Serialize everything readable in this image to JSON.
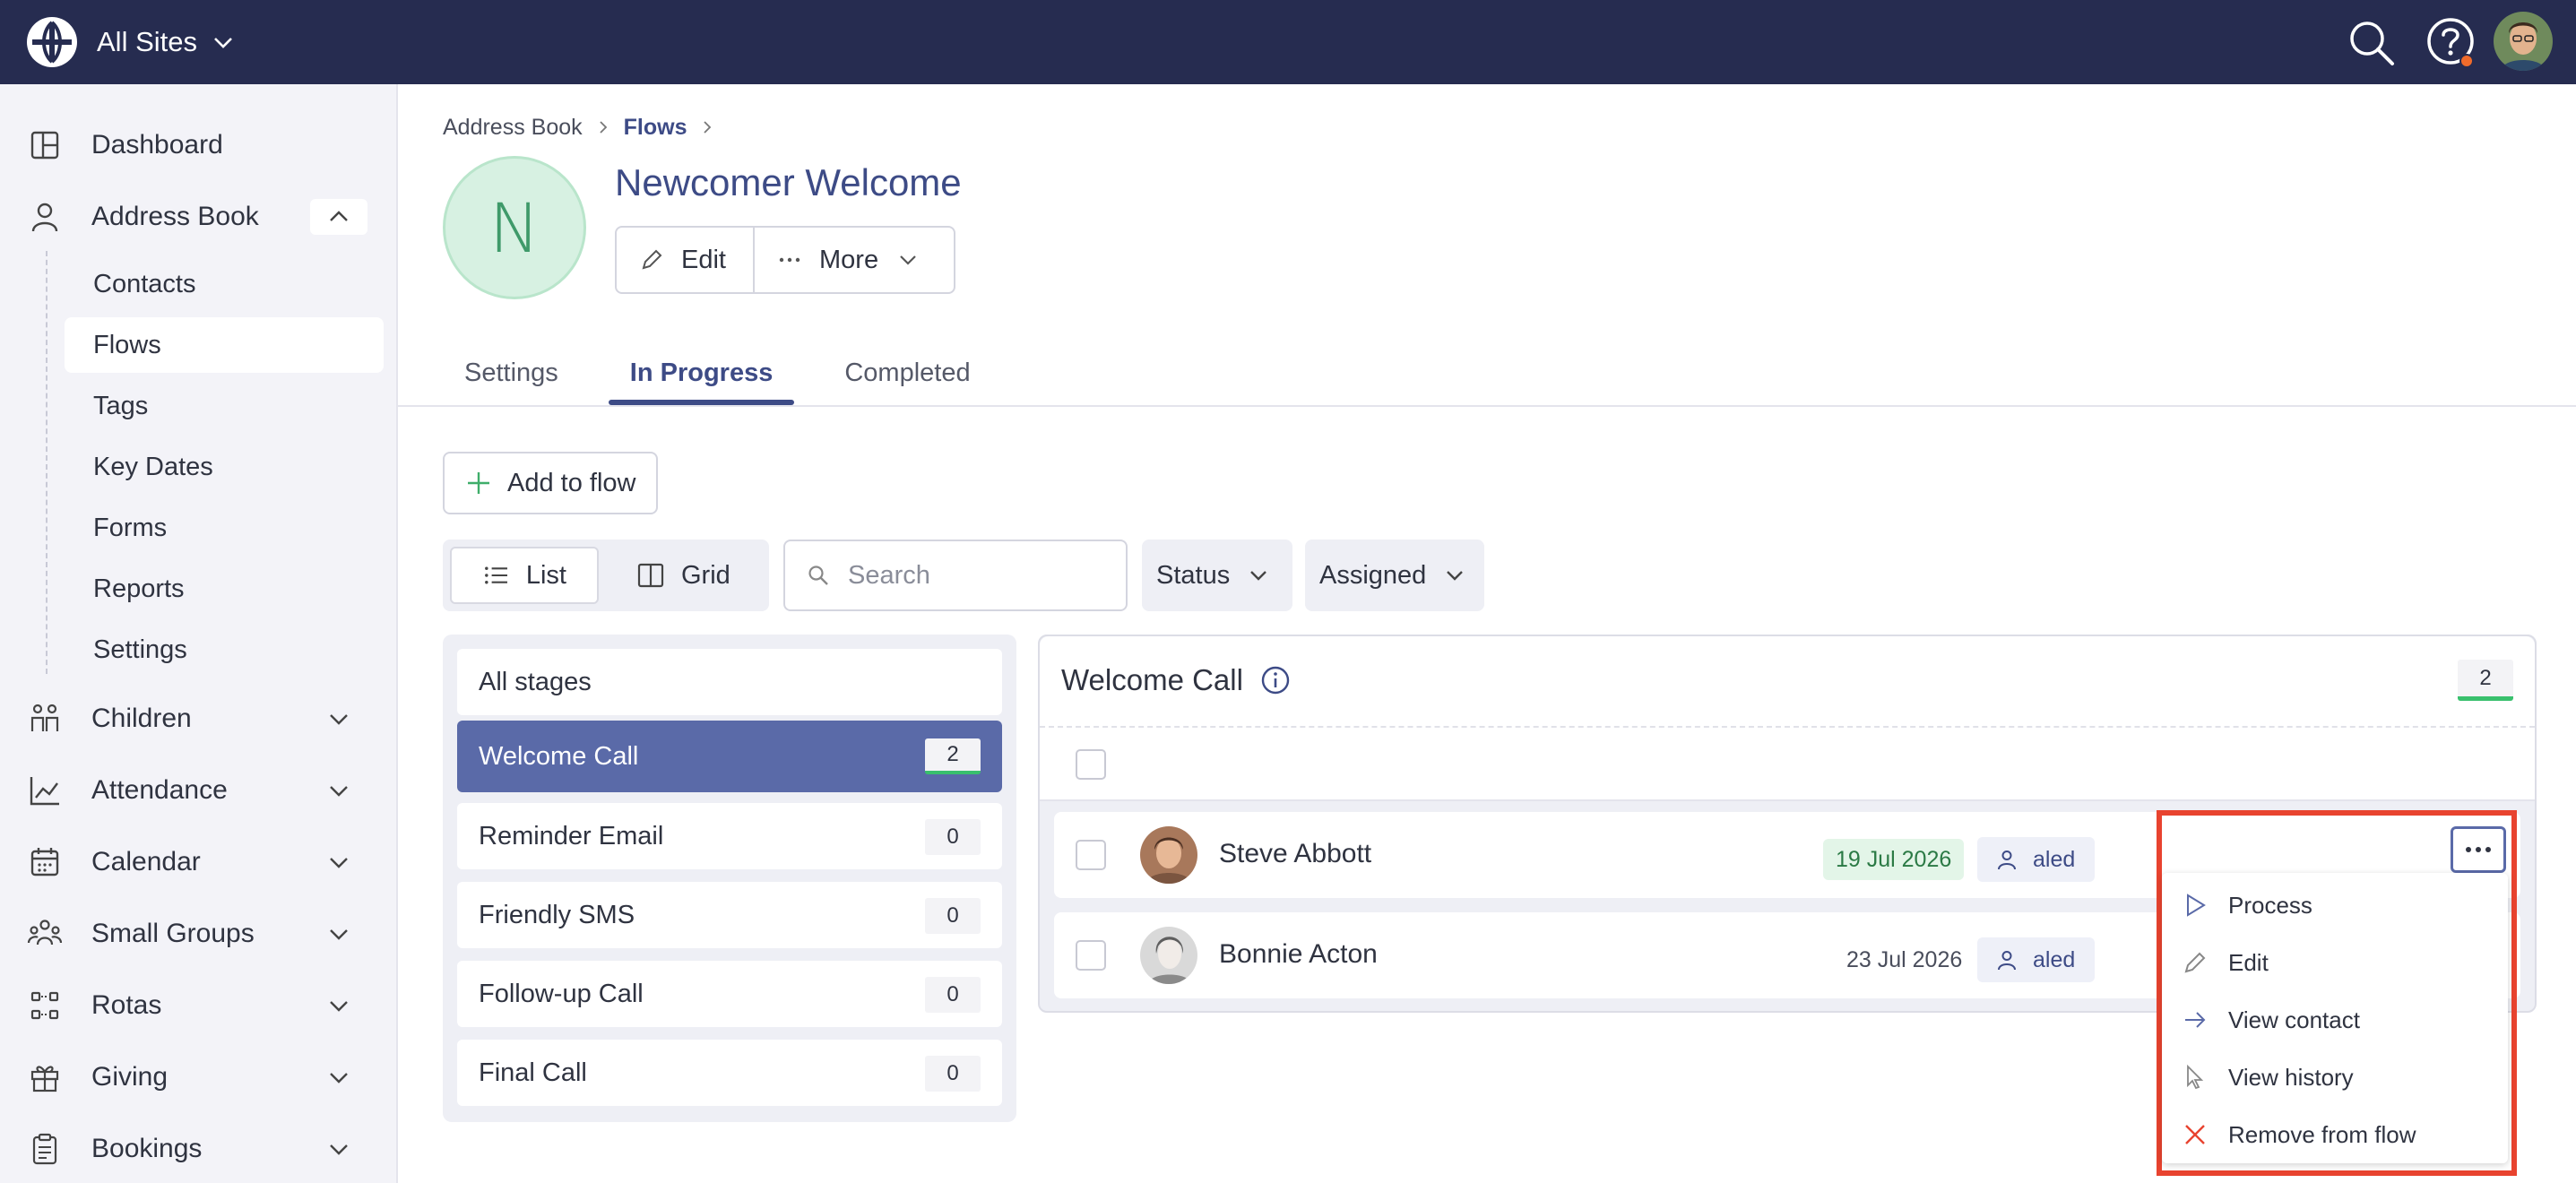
{
  "topbar": {
    "site_label": "All Sites",
    "icons": [
      "globe-logo-icon",
      "chevron-down-icon",
      "search-icon",
      "help-icon",
      "avatar"
    ],
    "help_badge_color": "#f06b2b",
    "background": "#262c50"
  },
  "sidebar": {
    "items": [
      {
        "label": "Dashboard",
        "icon": "dashboard-icon"
      },
      {
        "label": "Address Book",
        "icon": "person-icon",
        "expanded": true
      },
      {
        "label": "Children",
        "icon": "children-icon"
      },
      {
        "label": "Attendance",
        "icon": "chart-icon"
      },
      {
        "label": "Calendar",
        "icon": "calendar-icon"
      },
      {
        "label": "Small Groups",
        "icon": "groups-icon"
      },
      {
        "label": "Rotas",
        "icon": "rotas-icon"
      },
      {
        "label": "Giving",
        "icon": "gift-icon"
      },
      {
        "label": "Bookings",
        "icon": "clipboard-icon"
      }
    ],
    "address_book_sub": [
      {
        "label": "Contacts"
      },
      {
        "label": "Flows",
        "active": true
      },
      {
        "label": "Tags"
      },
      {
        "label": "Key Dates"
      },
      {
        "label": "Forms"
      },
      {
        "label": "Reports"
      },
      {
        "label": "Settings"
      }
    ]
  },
  "breadcrumb": {
    "root": "Address Book",
    "current": "Flows"
  },
  "flow": {
    "initial": "N",
    "title": "Newcomer Welcome",
    "edit_label": "Edit",
    "more_label": "More"
  },
  "tabs": [
    {
      "label": "Settings"
    },
    {
      "label": "In Progress",
      "active": true
    },
    {
      "label": "Completed"
    }
  ],
  "toolbar": {
    "add_label": "Add to flow",
    "list_label": "List",
    "grid_label": "Grid",
    "search_placeholder": "Search",
    "status_label": "Status",
    "assigned_label": "Assigned"
  },
  "stages": {
    "all_label": "All stages",
    "items": [
      {
        "label": "Welcome Call",
        "count": "2",
        "active": true
      },
      {
        "label": "Reminder Email",
        "count": "0"
      },
      {
        "label": "Friendly SMS",
        "count": "0"
      },
      {
        "label": "Follow-up Call",
        "count": "0"
      },
      {
        "label": "Final Call",
        "count": "0"
      }
    ]
  },
  "content": {
    "title": "Welcome Call",
    "count": "2",
    "rows": [
      {
        "name": "Steve Abbott",
        "date": "19 Jul 2026",
        "date_highlight": true,
        "assignee": "aled"
      },
      {
        "name": "Bonnie Acton",
        "date": "23 Jul 2026",
        "date_highlight": false,
        "assignee": "aled"
      }
    ]
  },
  "context_menu": {
    "items": [
      {
        "label": "Process",
        "icon": "play-icon"
      },
      {
        "label": "Edit",
        "icon": "pencil-icon"
      },
      {
        "label": "View contact",
        "icon": "arrow-right-icon"
      },
      {
        "label": "View history",
        "icon": "cursor-icon"
      },
      {
        "label": "Remove from flow",
        "icon": "close-icon"
      }
    ],
    "highlight_color": "#e8432f"
  },
  "colors": {
    "accent": "#3d4b86",
    "stage_active": "#5a6aa8",
    "success": "#39c06d",
    "danger": "#e8432f"
  }
}
